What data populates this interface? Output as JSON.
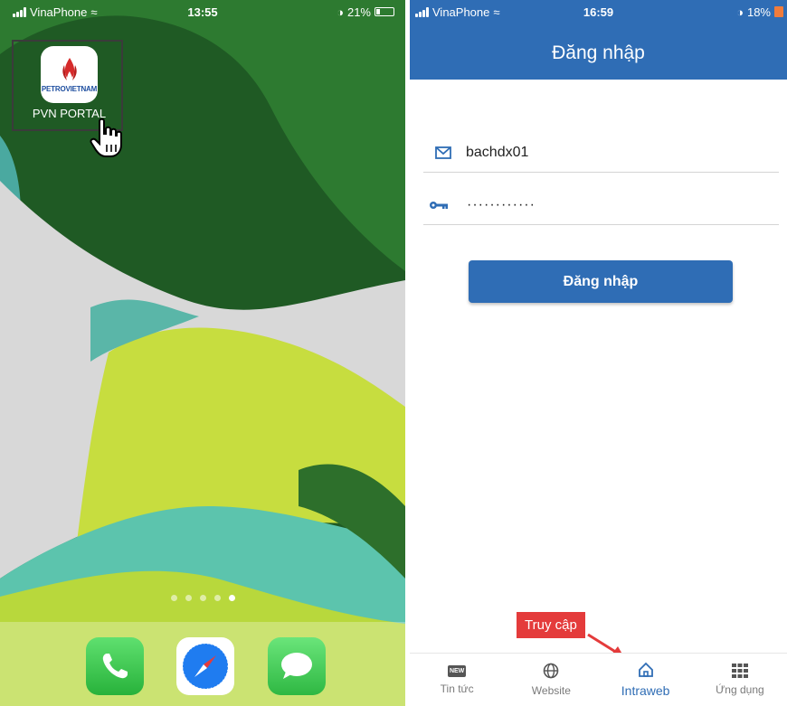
{
  "left_phone": {
    "status": {
      "carrier": "VinaPhone",
      "time": "13:55",
      "battery": "21%"
    },
    "app": {
      "logo_text": "PETROVIETNAM",
      "label": "PVN PORTAL",
      "icon": "petrovietnam-flame-icon"
    },
    "page_dots": {
      "count": 5,
      "active_index": 4
    },
    "dock": [
      "phone-icon",
      "safari-icon",
      "messages-icon"
    ],
    "colors": {
      "phone": "#36c24a",
      "safari": "#1f7cf0",
      "messages": "#3cc94c"
    }
  },
  "right_phone": {
    "status": {
      "carrier": "VinaPhone",
      "time": "16:59",
      "battery": "18%"
    },
    "header_title": "Đăng nhập",
    "username": {
      "icon": "mail-icon",
      "value": "bachdx01"
    },
    "password": {
      "icon": "key-icon",
      "value": "············"
    },
    "login_button": "Đăng nhập",
    "tooltip": "Truy cập",
    "tabs": [
      {
        "label": "Tin tức",
        "icon": "news-icon"
      },
      {
        "label": "Website",
        "icon": "globe-icon"
      },
      {
        "label": "Intraweb",
        "icon": "home-icon"
      },
      {
        "label": "Ứng dụng",
        "icon": "grid-apps-icon"
      }
    ],
    "active_tab": "Intraweb",
    "colors": {
      "primary": "#2f6db5",
      "tooltip": "#e43b3b"
    }
  }
}
